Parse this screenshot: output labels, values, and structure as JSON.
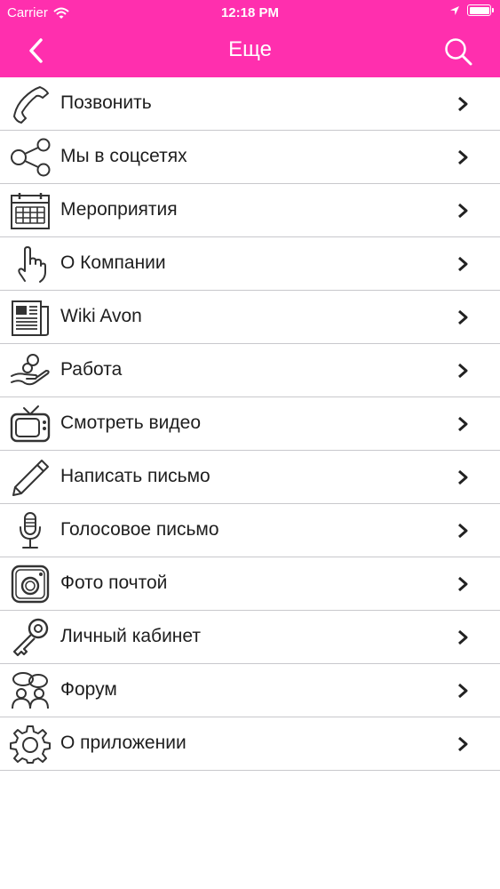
{
  "status_bar": {
    "carrier": "Carrier",
    "time": "12:18 PM"
  },
  "nav": {
    "title": "Еще",
    "back_icon": "chevron-left-icon",
    "search_icon": "search-icon"
  },
  "colors": {
    "header": "#ff2fae",
    "text": "#1e1e1e",
    "separator": "#c8c8cc"
  },
  "menu": {
    "items": [
      {
        "label": "Позвонить",
        "icon": "phone-icon"
      },
      {
        "label": "Мы в соцсетях",
        "icon": "share-icon"
      },
      {
        "label": "Мероприятия",
        "icon": "calendar-icon"
      },
      {
        "label": "О Компании",
        "icon": "pointing-hand-icon"
      },
      {
        "label": "Wiki Avon",
        "icon": "newspaper-icon"
      },
      {
        "label": "Работа",
        "icon": "hand-coins-icon"
      },
      {
        "label": "Смотреть видео",
        "icon": "tv-icon"
      },
      {
        "label": "Написать письмо",
        "icon": "pencil-icon"
      },
      {
        "label": "Голосовое письмо",
        "icon": "microphone-icon"
      },
      {
        "label": "Фото почтой",
        "icon": "camera-icon"
      },
      {
        "label": "Личный кабинет",
        "icon": "key-icon"
      },
      {
        "label": "Форум",
        "icon": "forum-people-icon"
      },
      {
        "label": "О приложении",
        "icon": "gear-icon"
      }
    ]
  }
}
